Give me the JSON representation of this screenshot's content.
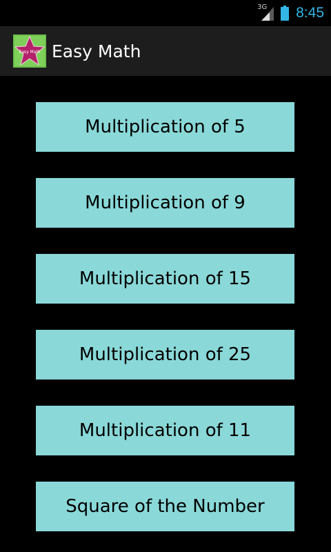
{
  "status_bar": {
    "network_type": "3G",
    "time": "8:45",
    "clock_color": "#33b5e5",
    "icons": [
      "signal-icon",
      "battery-icon"
    ]
  },
  "action_bar": {
    "title": "Easy Math",
    "app_icon_text": "Easy Math",
    "app_icon": "star-icon"
  },
  "menu": {
    "button_color": "#8ad8d8",
    "items": [
      {
        "label": "Multiplication of 5"
      },
      {
        "label": "Multiplication of 9"
      },
      {
        "label": "Multiplication of 15"
      },
      {
        "label": "Multiplication of 25"
      },
      {
        "label": "Multiplication of 11"
      },
      {
        "label": "Square of the Number"
      }
    ]
  }
}
